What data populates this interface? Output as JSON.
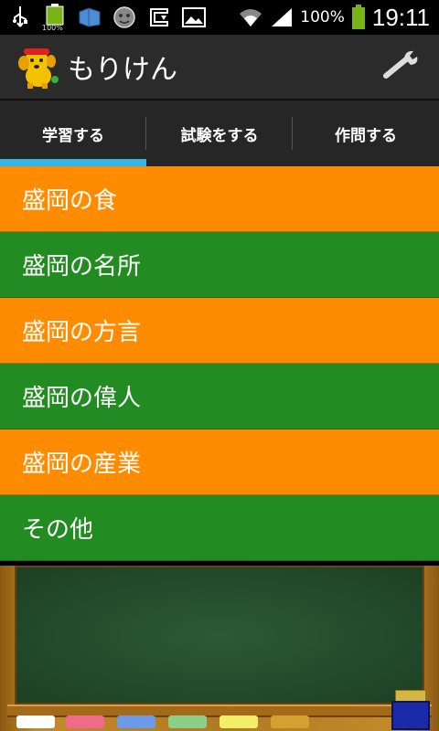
{
  "status_bar": {
    "battery_small_label": "100%",
    "battery_pct": "100%",
    "clock": "19:11",
    "icons": [
      "usb-icon",
      "battery-charging-icon",
      "notification-icon",
      "app-notification-icon",
      "download-icon",
      "image-icon",
      "wifi-icon",
      "signal-icon",
      "battery-icon"
    ]
  },
  "action_bar": {
    "title": "もりけん",
    "settings_icon": "wrench-icon"
  },
  "tabs": [
    {
      "label": "学習する",
      "selected": true
    },
    {
      "label": "試験をする",
      "selected": false
    },
    {
      "label": "作問する",
      "selected": false
    }
  ],
  "menu": {
    "items": [
      {
        "label": "盛岡の食",
        "color": "#ff8c00"
      },
      {
        "label": "盛岡の名所",
        "color": "#228b22"
      },
      {
        "label": "盛岡の方言",
        "color": "#ff8c00"
      },
      {
        "label": "盛岡の偉人",
        "color": "#228b22"
      },
      {
        "label": "盛岡の産業",
        "color": "#ff8c00"
      },
      {
        "label": "その他",
        "color": "#228b22"
      }
    ]
  },
  "colors": {
    "accent": "#33b5e5",
    "orange": "#ff8c00",
    "green": "#228b22",
    "board": "#234a2b"
  },
  "chalks": [
    "#ffffff",
    "#f06a8a",
    "#6a9ae8",
    "#8ad08a",
    "#f2ee6a",
    "#d4a030"
  ]
}
